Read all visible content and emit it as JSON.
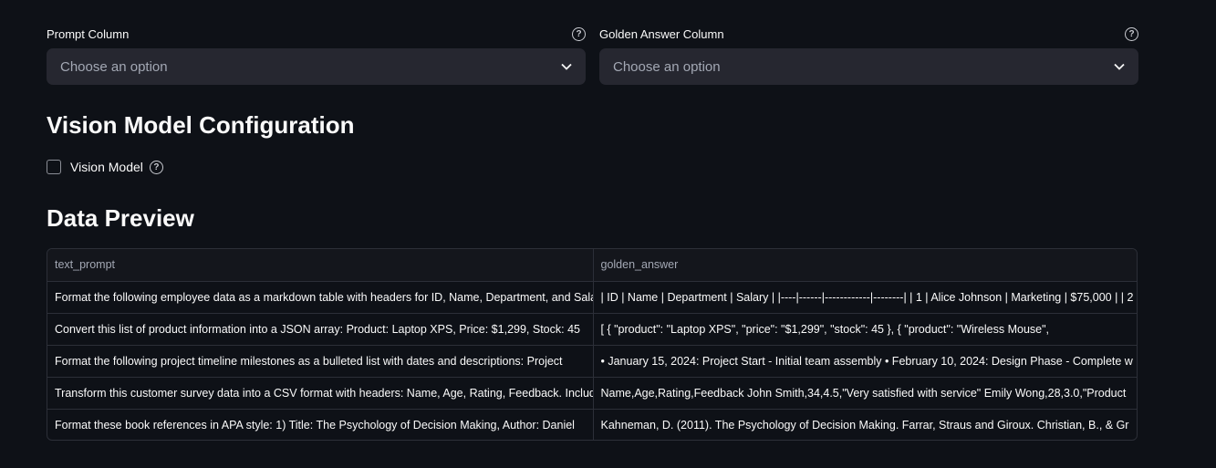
{
  "form": {
    "prompt_column": {
      "label": "Prompt Column",
      "placeholder": "Choose an option"
    },
    "golden_answer_column": {
      "label": "Golden Answer Column",
      "placeholder": "Choose an option"
    }
  },
  "vision": {
    "title": "Vision Model Configuration",
    "checkbox_label": "Vision Model",
    "checked": false
  },
  "preview": {
    "title": "Data Preview",
    "columns": [
      "text_prompt",
      "golden_answer"
    ],
    "rows": [
      [
        "Format the following employee data as a markdown table with headers for ID, Name, Department, and Salary",
        "| ID | Name | Department | Salary | |----|------|------------|--------| | 1 | Alice Johnson | Marketing | $75,000 | | 2"
      ],
      [
        "Convert this list of product information into a JSON array: Product: Laptop XPS, Price: $1,299, Stock: 45",
        "[  {    \"product\": \"Laptop XPS\",    \"price\": \"$1,299\",    \"stock\": 45  },  {    \"product\": \"Wireless Mouse\","
      ],
      [
        "Format the following project timeline milestones as a bulleted list with dates and descriptions: Project",
        "• January 15, 2024: Project Start - Initial team assembly • February 10, 2024: Design Phase - Complete w"
      ],
      [
        "Transform this customer survey data into a CSV format with headers: Name, Age, Rating, Feedback. Include",
        "Name,Age,Rating,Feedback John Smith,34,4.5,\"Very satisfied with service\" Emily Wong,28,3.0,\"Product"
      ],
      [
        "Format these book references in APA style: 1) Title: The Psychology of Decision Making, Author: Daniel",
        "Kahneman, D. (2011). The Psychology of Decision Making. Farrar, Straus and Giroux.  Christian, B., & Gr"
      ]
    ]
  },
  "icons": {
    "help": "question-circle-icon",
    "chevron": "chevron-down-icon"
  }
}
